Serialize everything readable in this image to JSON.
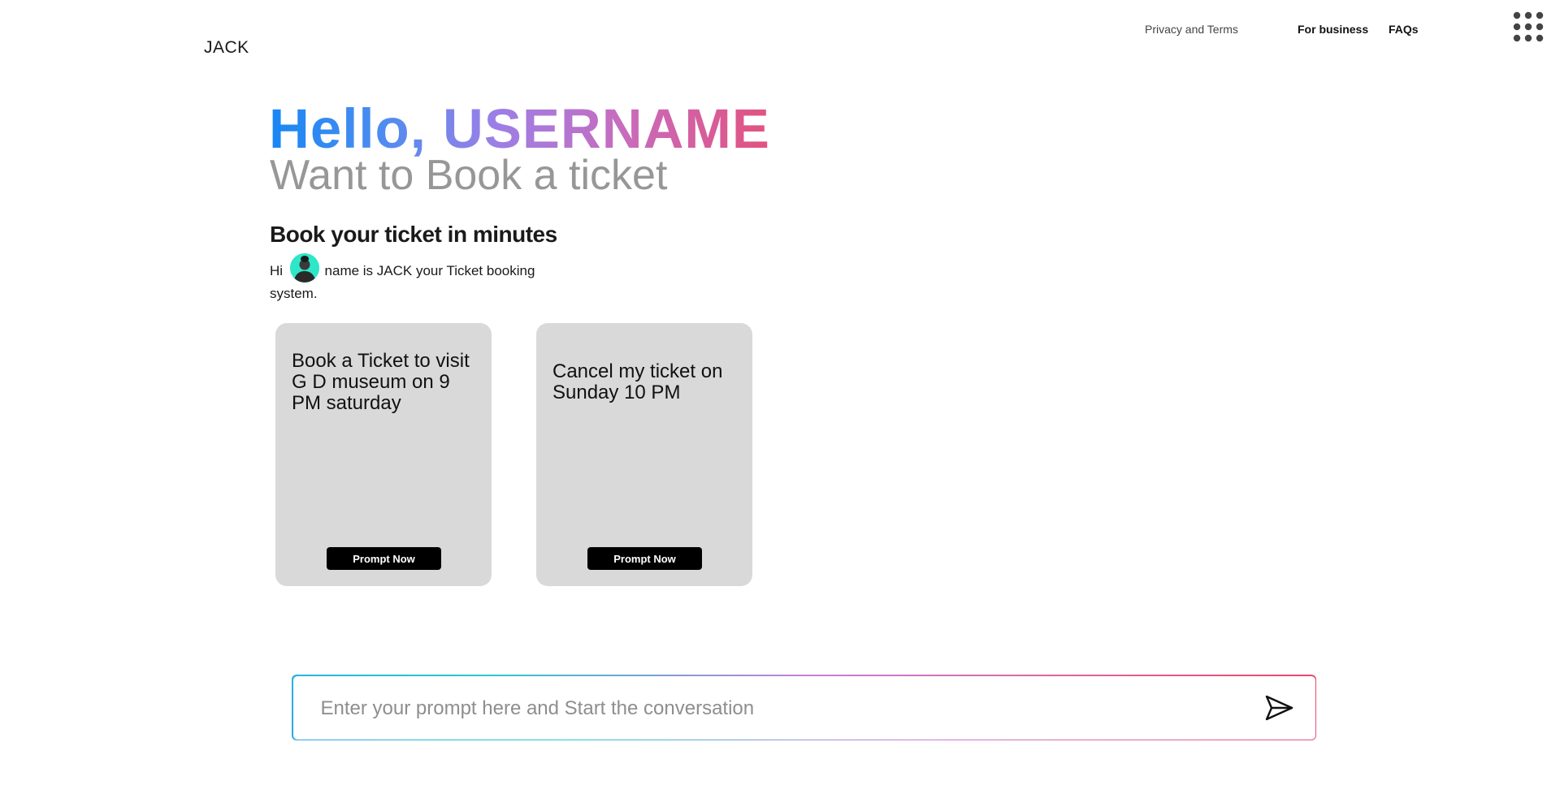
{
  "header": {
    "brand": "JACK",
    "nav": {
      "privacy": "Privacy and Terms",
      "business": "For business",
      "faqs": "FAQs"
    },
    "apps_icon": "grid-dots-icon"
  },
  "hero": {
    "greeting": "Hello, USERNAME",
    "subtitle": "Want to Book a ticket"
  },
  "intro": {
    "title": "Book your ticket in minutes",
    "text_before": "Hi",
    "text_after": "name is JACK your Ticket booking system.",
    "avatar_icon": "assistant-avatar"
  },
  "cards": [
    {
      "text": "Book a Ticket to visit G D museum on 9 PM saturday",
      "button": "Prompt Now"
    },
    {
      "text": "Cancel my ticket on Sunday 10 PM",
      "button": "Prompt Now"
    }
  ],
  "prompt": {
    "placeholder": "Enter your prompt here and Start the conversation",
    "send_icon": "send-icon"
  },
  "colors": {
    "card_bg": "#d9d9d9",
    "button_bg": "#000000",
    "subtitle": "#979797",
    "gradient_start": "#1887f4",
    "gradient_end": "#e2527f"
  }
}
